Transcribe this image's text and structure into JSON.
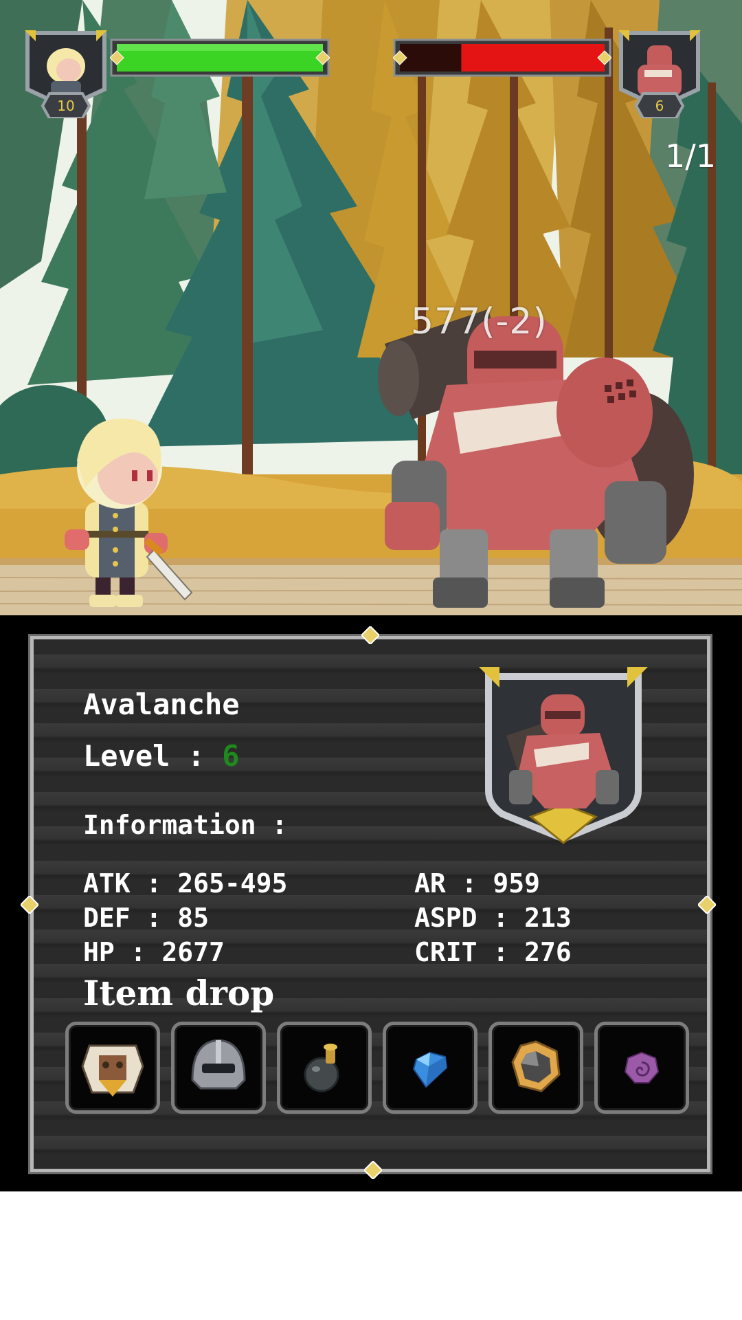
{
  "player": {
    "level": "10",
    "hp_fraction": 1.0
  },
  "enemy": {
    "level": "6",
    "hp_fraction": 0.7
  },
  "wave_counter": "1/1",
  "damage_popup": "577(-2)",
  "info": {
    "name": "Avalanche",
    "level_label": "Level : ",
    "level_value": "6",
    "information_label": "Information :",
    "stats": {
      "atk": "ATK : 265-495",
      "def": "DEF : 85",
      "hp": "HP : 2677",
      "ar": "AR : 959",
      "aspd": "ASPD : 213",
      "crit": "CRIT : 276"
    },
    "item_drop_label": "Item drop",
    "item_drops": [
      "armor-icon",
      "helmet-icon",
      "bomb-potion-icon",
      "blue-gem-icon",
      "amulet-icon",
      "purple-rune-icon"
    ]
  },
  "colors": {
    "player_hp": "#3cd424",
    "enemy_hp": "#e41414",
    "enemy_hp_empty": "#2b0c08",
    "level_value": "#1e8a1e",
    "badge_text": "#e4c847"
  }
}
